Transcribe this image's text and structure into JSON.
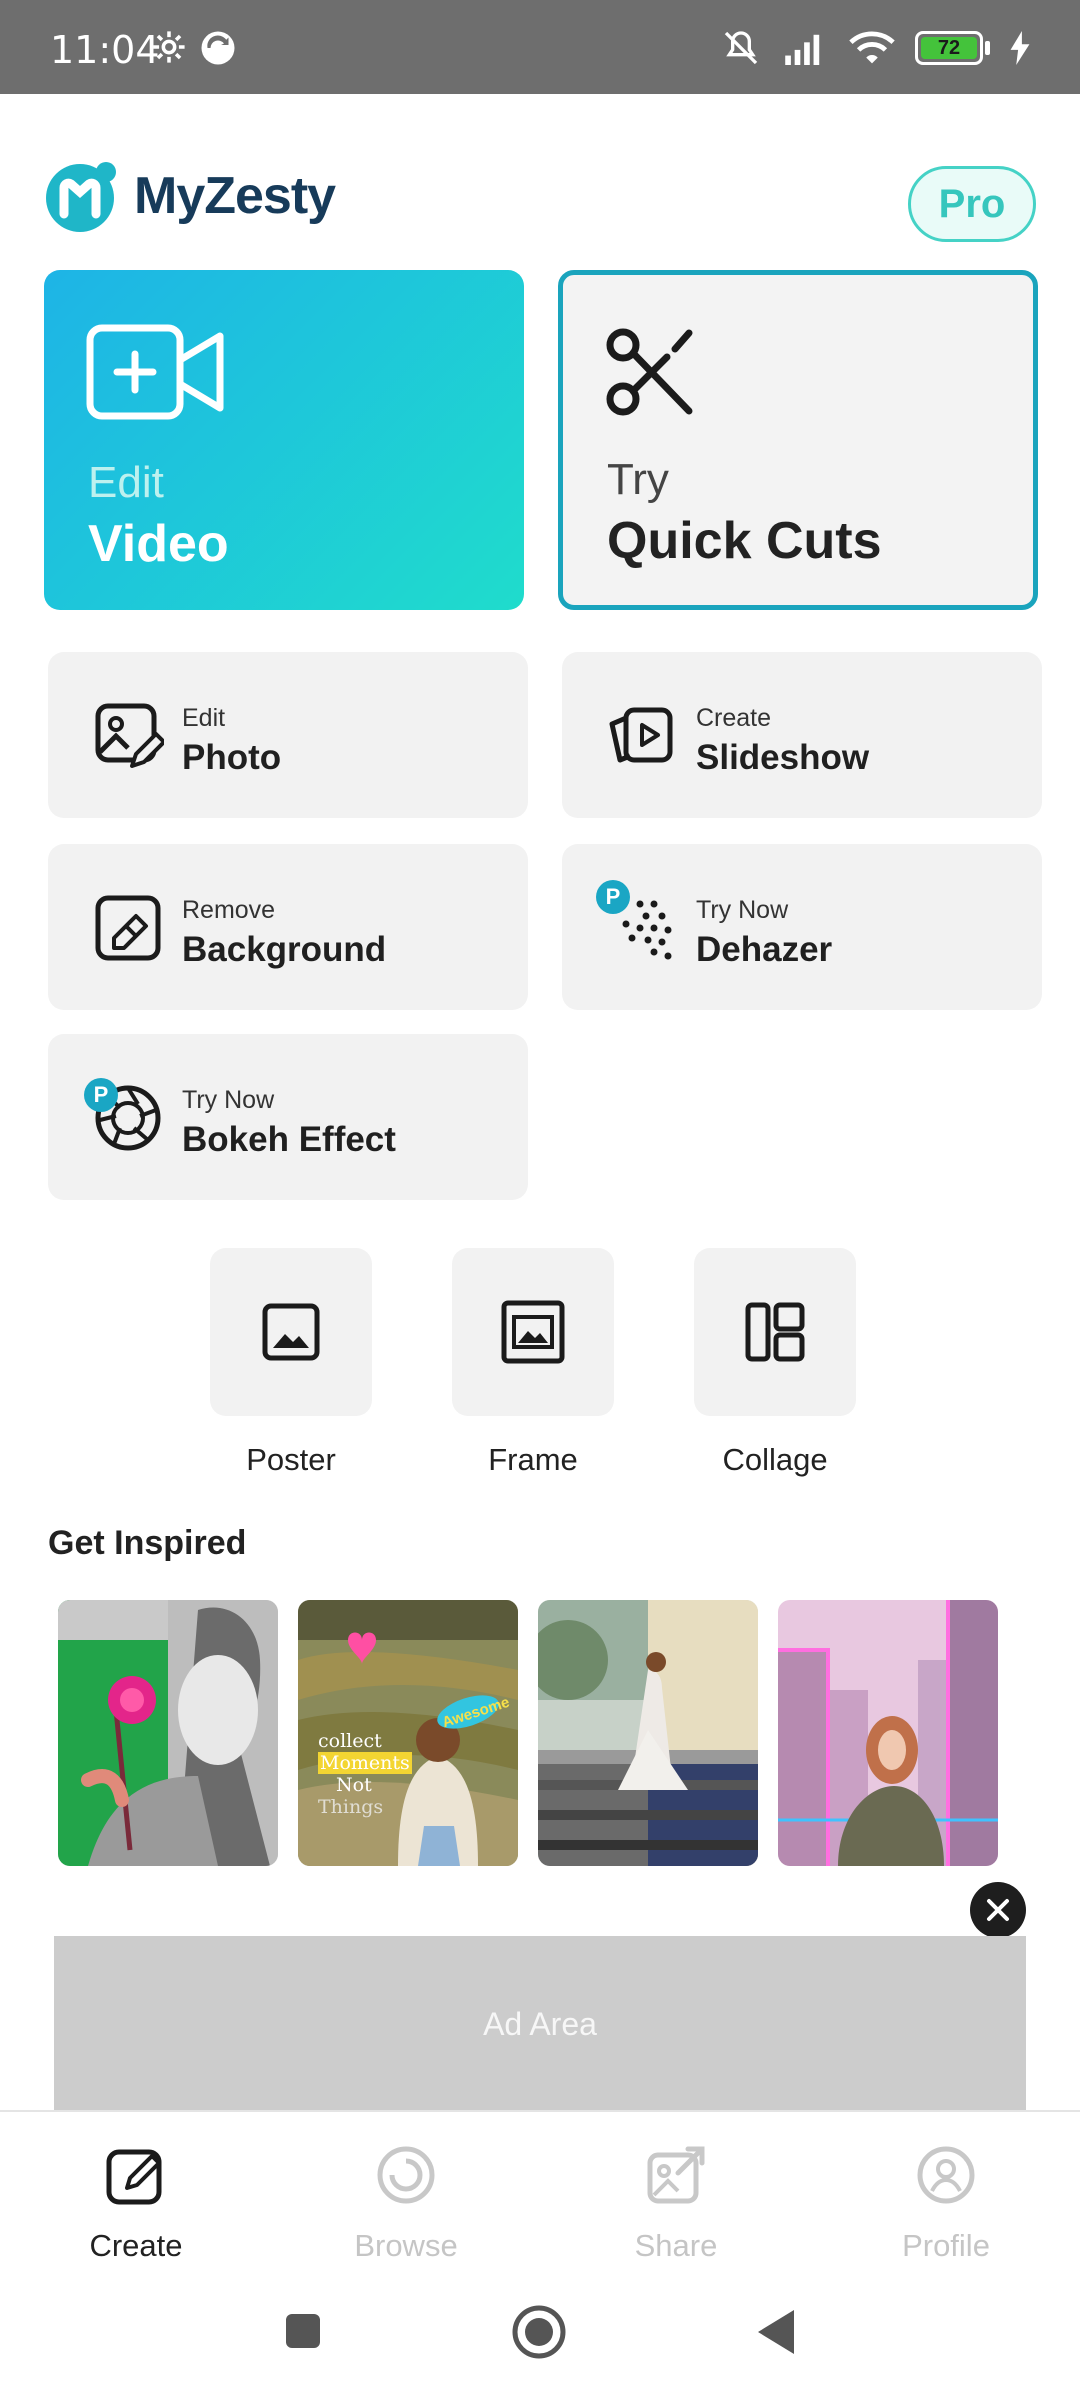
{
  "status_bar": {
    "time": "11:04",
    "battery": "72"
  },
  "header": {
    "app_name": "MyZesty",
    "pro_label": "Pro"
  },
  "hero_cards": {
    "edit_video": {
      "small": "Edit",
      "large": "Video"
    },
    "quick_cuts": {
      "small": "Try",
      "large": "Quick Cuts"
    }
  },
  "features": {
    "photo": {
      "small": "Edit",
      "large": "Photo"
    },
    "slideshow": {
      "small": "Create",
      "large": "Slideshow"
    },
    "background": {
      "small": "Remove",
      "large": "Background"
    },
    "dehazer": {
      "small": "Try Now",
      "large": "Dehazer",
      "badge": "P"
    },
    "bokeh": {
      "small": "Try Now",
      "large": "Bokeh Effect",
      "badge": "P"
    }
  },
  "tools": {
    "poster": "Poster",
    "frame": "Frame",
    "collage": "Collage"
  },
  "inspired": {
    "title": "Get Inspired",
    "thumb2_text": [
      "collect",
      "Moments",
      "Not",
      "Things"
    ],
    "thumb2_sticker": "Awesome"
  },
  "ad": {
    "label": "Ad Area"
  },
  "bottom_nav": {
    "create": "Create",
    "browse": "Browse",
    "share": "Share",
    "profile": "Profile"
  },
  "colors": {
    "accent": "#1aa4bd",
    "gradient_start": "#1eb4e6",
    "gradient_end": "#1fdccc",
    "pro": "#45d2c6",
    "tile_bg": "#f2f2f2"
  },
  "icons": {
    "status": [
      "settings-gear-icon",
      "sync-icon",
      "mute-icon",
      "signal-icon",
      "wifi-icon",
      "battery-icon",
      "charging-icon"
    ],
    "hero": [
      "video-add-icon",
      "scissors-icon"
    ],
    "features": [
      "photo-edit-icon",
      "slideshow-icon",
      "eraser-icon",
      "dehaze-icon",
      "aperture-icon"
    ],
    "tools": [
      "image-icon",
      "frame-icon",
      "collage-icon"
    ],
    "nav": [
      "edit-icon",
      "browse-icon",
      "share-icon",
      "profile-icon"
    ]
  }
}
